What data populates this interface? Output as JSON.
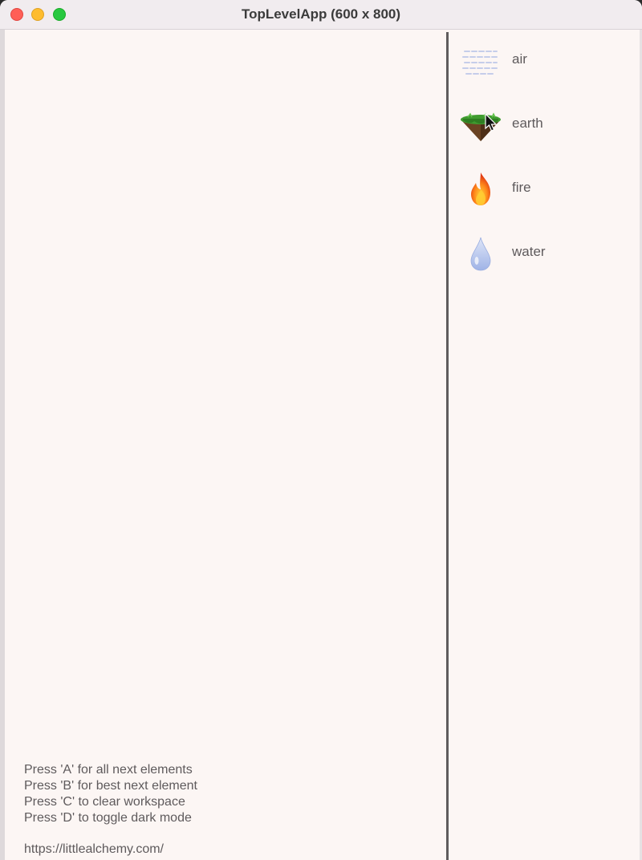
{
  "window": {
    "title": "TopLevelApp (600 x 800)"
  },
  "elements": [
    {
      "label": "air",
      "icon": "air-icon"
    },
    {
      "label": "earth",
      "icon": "earth-icon"
    },
    {
      "label": "fire",
      "icon": "fire-icon"
    },
    {
      "label": "water",
      "icon": "water-icon"
    }
  ],
  "instructions": [
    "Press 'A' for all next elements",
    "Press 'B' for best next element",
    "Press 'C' to clear workspace",
    "Press 'D' to toggle dark mode"
  ],
  "url": "https://littlealchemy.com/",
  "colors": {
    "background": "#fcf6f4",
    "text": "#5e5a5c",
    "divider": "#5f5c5d"
  }
}
